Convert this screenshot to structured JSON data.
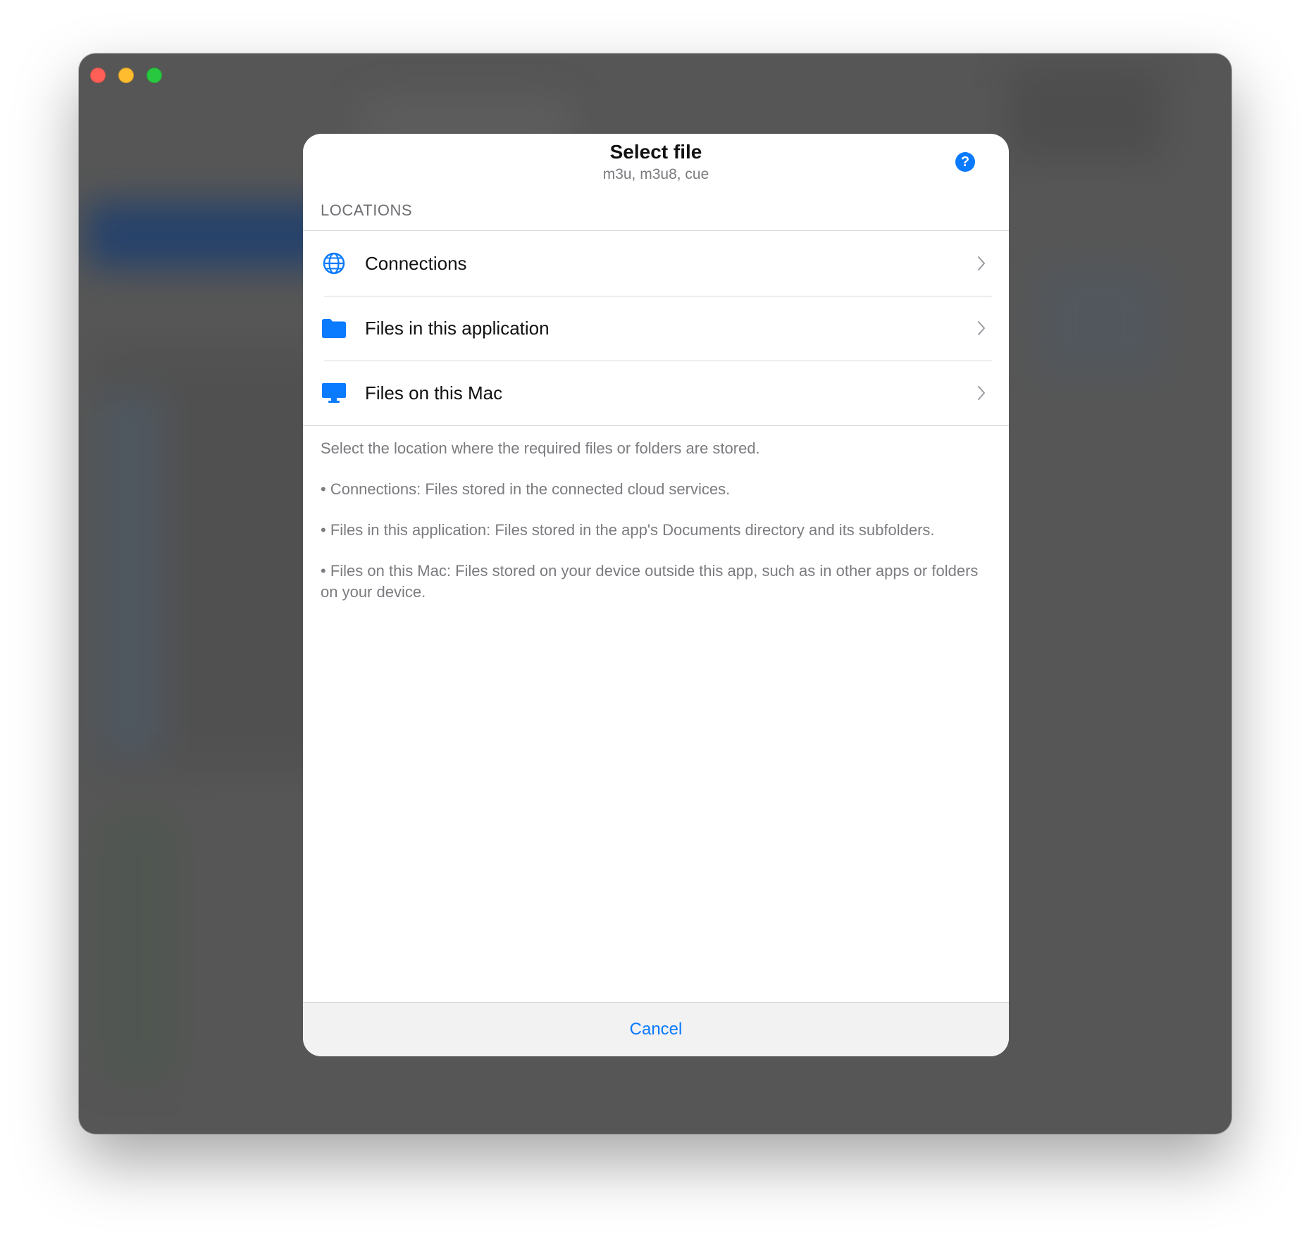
{
  "window": {
    "controls": [
      "close",
      "minimize",
      "zoom"
    ]
  },
  "dialog": {
    "title": "Select file",
    "subtitle": "m3u, m3u8, cue",
    "help_label": "?",
    "section_label": "LOCATIONS",
    "locations": [
      {
        "label": "Connections",
        "icon": "globe-icon"
      },
      {
        "label": "Files in this application",
        "icon": "folder-icon"
      },
      {
        "label": "Files on this Mac",
        "icon": "desktop-computer-icon"
      }
    ],
    "info": {
      "intro": "Select the location where the required files or folders are stored.",
      "connections": "• Connections: Files stored in the connected cloud services.",
      "app_files": "• Files in this application: Files stored in the app's Documents directory and its subfolders.",
      "mac_files": "• Files on this Mac: Files stored on your device outside this app, such as in other apps or folders on your device."
    },
    "cancel_label": "Cancel"
  },
  "colors": {
    "accent": "#0a7aff",
    "window_background": "#565656",
    "secondary_text": "#7b7b80"
  }
}
